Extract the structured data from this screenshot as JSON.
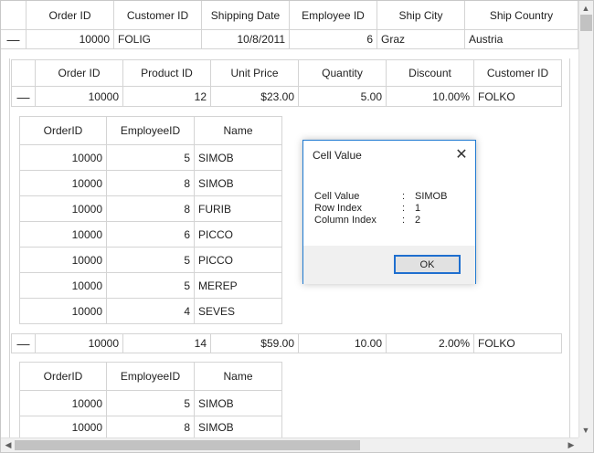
{
  "parent_grid": {
    "columns": [
      "Order ID",
      "Customer ID",
      "Shipping Date",
      "Employee ID",
      "Ship City",
      "Ship Country"
    ],
    "row": {
      "expand": "—",
      "order_id": "10000",
      "customer_id": "FOLIG",
      "shipping_date": "10/8/2011",
      "employee_id": "6",
      "ship_city": "Graz",
      "ship_country": "Austria"
    }
  },
  "child_grid": {
    "columns": [
      "Order ID",
      "Product ID",
      "Unit Price",
      "Quantity",
      "Discount",
      "Customer ID"
    ],
    "rows": [
      {
        "expand": "—",
        "order_id": "10000",
        "product_id": "12",
        "unit_price": "$23.00",
        "quantity": "5.00",
        "discount": "10.00%",
        "customer_id": "FOLKO"
      },
      {
        "expand": "—",
        "order_id": "10000",
        "product_id": "14",
        "unit_price": "$59.00",
        "quantity": "10.00",
        "discount": "2.00%",
        "customer_id": "FOLKO"
      }
    ]
  },
  "nested_grid_1": {
    "columns": [
      "OrderID",
      "EmployeeID",
      "Name"
    ],
    "rows": [
      [
        "10000",
        "5",
        "SIMOB"
      ],
      [
        "10000",
        "8",
        "SIMOB"
      ],
      [
        "10000",
        "8",
        "FURIB"
      ],
      [
        "10000",
        "6",
        "PICCO"
      ],
      [
        "10000",
        "5",
        "PICCO"
      ],
      [
        "10000",
        "5",
        "MEREP"
      ],
      [
        "10000",
        "4",
        "SEVES"
      ]
    ]
  },
  "nested_grid_2": {
    "columns": [
      "OrderID",
      "EmployeeID",
      "Name"
    ],
    "rows": [
      [
        "10000",
        "5",
        "SIMOB"
      ],
      [
        "10000",
        "8",
        "SIMOB"
      ]
    ]
  },
  "dialog": {
    "title": "Cell Value",
    "close_glyph": "✕",
    "fields": [
      {
        "label": "Cell Value",
        "sep": ":",
        "value": "SIMOB"
      },
      {
        "label": "Row Index",
        "sep": ":",
        "value": "1"
      },
      {
        "label": "Column Index",
        "sep": ":",
        "value": "2"
      }
    ],
    "ok_label": "OK"
  },
  "scrollbar": {
    "up": "▲",
    "down": "▼",
    "left": "◀",
    "right": "▶"
  }
}
